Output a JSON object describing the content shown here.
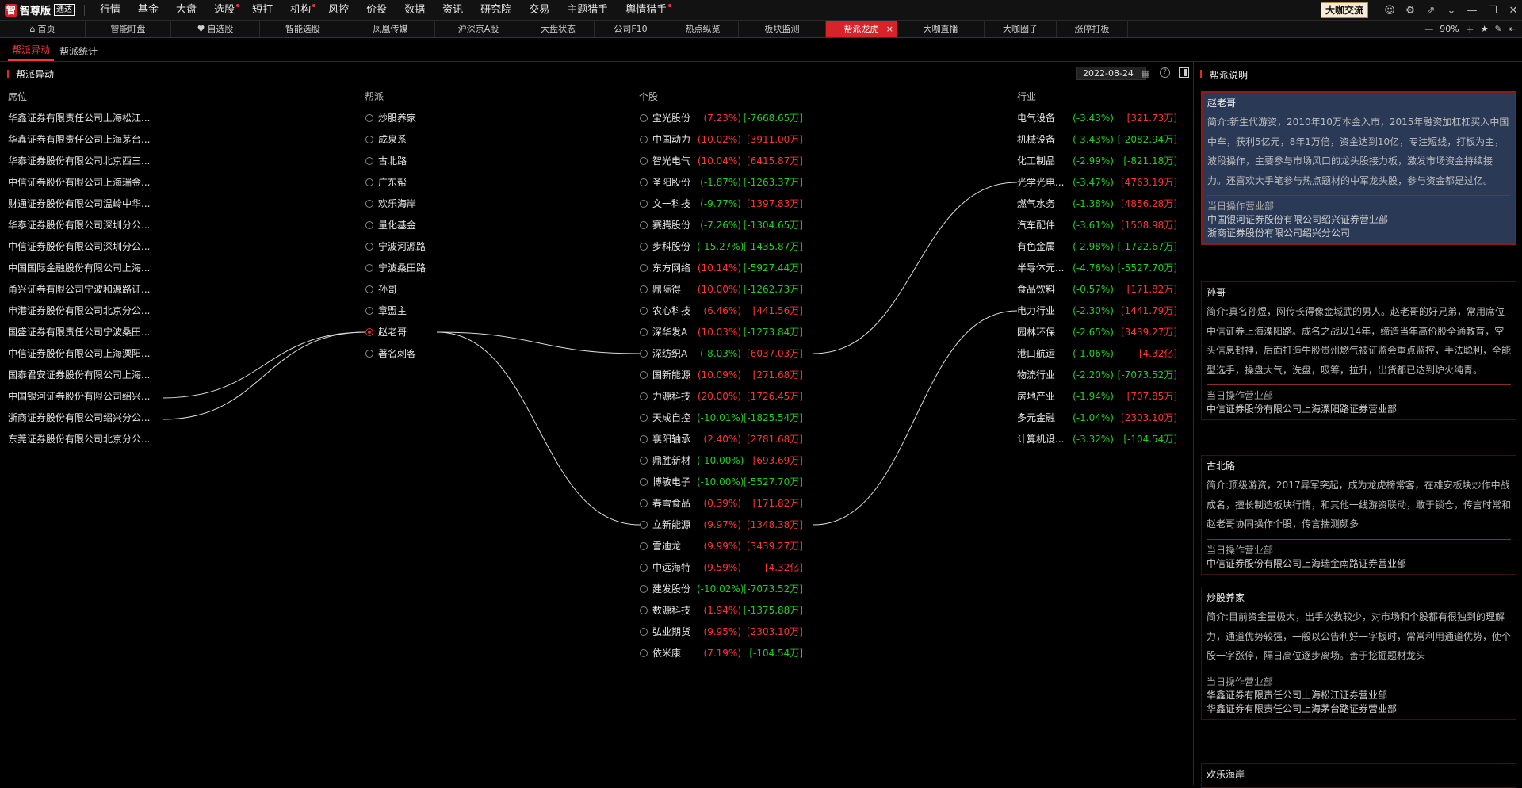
{
  "app": {
    "logo_badge": "智",
    "logo_text": "智尊版",
    "logo_sub": "通达",
    "menu": [
      {
        "label": "行情",
        "dot": false
      },
      {
        "label": "基金",
        "dot": false
      },
      {
        "label": "大盘",
        "dot": false
      },
      {
        "label": "选股",
        "dot": true
      },
      {
        "label": "短打",
        "dot": false
      },
      {
        "label": "机构",
        "dot": true
      },
      {
        "label": "风控",
        "dot": false
      },
      {
        "label": "价投",
        "dot": false
      },
      {
        "label": "数据",
        "dot": false
      },
      {
        "label": "资讯",
        "dot": false
      },
      {
        "label": "研究院",
        "dot": false
      },
      {
        "label": "交易",
        "dot": false
      },
      {
        "label": "主题猎手",
        "dot": false
      },
      {
        "label": "舆情猎手",
        "dot": true
      }
    ],
    "bigv_button": "大咖交流"
  },
  "tabs": [
    {
      "label": "首页",
      "icon": "home-icon",
      "active": false
    },
    {
      "label": "智能盯盘",
      "active": false
    },
    {
      "label": "自选股",
      "icon": "heart-icon",
      "active": false
    },
    {
      "label": "智能选股",
      "active": false
    },
    {
      "label": "凤凰传媒",
      "active": false
    },
    {
      "label": "沪深京A股",
      "active": false
    },
    {
      "label": "大盘状态",
      "active": false
    },
    {
      "label": "公司F10",
      "active": false
    },
    {
      "label": "热点纵览",
      "active": false
    },
    {
      "label": "板块监测",
      "active": false
    },
    {
      "label": "帮派龙虎",
      "active": true
    },
    {
      "label": "大咖直播",
      "active": false
    },
    {
      "label": "大咖圈子",
      "active": false
    },
    {
      "label": "涨停打板",
      "active": false
    }
  ],
  "zoom": "90%",
  "subtabs": [
    {
      "label": "帮派异动",
      "active": true
    },
    {
      "label": "帮派统计",
      "active": false
    }
  ],
  "panel": {
    "title": "帮派异动",
    "date": "2022-08-24",
    "headers": {
      "seat": "席位",
      "gang": "帮派",
      "stock": "个股",
      "industry": "行业"
    }
  },
  "seats": [
    "华鑫证券有限责任公司上海松江...",
    "华鑫证券有限责任公司上海茅台...",
    "华泰证券股份有限公司北京西三...",
    "中信证券股份有限公司上海瑞金...",
    "财通证券股份有限公司温岭中华...",
    "华泰证券股份有限公司深圳分公...",
    "中信证券股份有限公司深圳分公...",
    "中国国际金融股份有限公司上海...",
    "甬兴证券有限公司宁波和源路证...",
    "申港证券股份有限公司北京分公...",
    "国盛证券有限责任公司宁波桑田...",
    "中信证券股份有限公司上海溧阳...",
    "国泰君安证券股份有限公司上海...",
    "中国银河证券股份有限公司绍兴...",
    "浙商证券股份有限公司绍兴分公...",
    "东莞证券股份有限公司北京分公..."
  ],
  "gangs": [
    {
      "name": "炒股养家",
      "selected": false
    },
    {
      "name": "成泉系",
      "selected": false
    },
    {
      "name": "古北路",
      "selected": false
    },
    {
      "name": "广东帮",
      "selected": false
    },
    {
      "name": "欢乐海岸",
      "selected": false
    },
    {
      "name": "量化基金",
      "selected": false
    },
    {
      "name": "宁波河源路",
      "selected": false
    },
    {
      "name": "宁波桑田路",
      "selected": false
    },
    {
      "name": "孙哥",
      "selected": false
    },
    {
      "name": "章盟主",
      "selected": false
    },
    {
      "name": "赵老哥",
      "selected": true
    },
    {
      "name": "著名刺客",
      "selected": false
    }
  ],
  "stocks": [
    {
      "name": "宝光股份",
      "pct": "(7.23%)",
      "amt": "[-7668.65万]",
      "pct_dir": "up",
      "amt_dir": "down"
    },
    {
      "name": "中国动力",
      "pct": "(10.02%)",
      "amt": "[3911.00万]",
      "pct_dir": "up",
      "amt_dir": "up"
    },
    {
      "name": "智光电气",
      "pct": "(10.04%)",
      "amt": "[6415.87万]",
      "pct_dir": "up",
      "amt_dir": "up"
    },
    {
      "name": "圣阳股份",
      "pct": "(-1.87%)",
      "amt": "[-1263.37万]",
      "pct_dir": "down",
      "amt_dir": "down"
    },
    {
      "name": "文一科技",
      "pct": "(-9.77%)",
      "amt": "[1397.83万]",
      "pct_dir": "down",
      "amt_dir": "up"
    },
    {
      "name": "赛腾股份",
      "pct": "(-7.26%)",
      "amt": "[-1304.65万]",
      "pct_dir": "down",
      "amt_dir": "down"
    },
    {
      "name": "步科股份",
      "pct": "(-15.27%)",
      "amt": "[-1435.87万]",
      "pct_dir": "down",
      "amt_dir": "down"
    },
    {
      "name": "东方网络",
      "pct": "(10.14%)",
      "amt": "[-5927.44万]",
      "pct_dir": "up",
      "amt_dir": "down"
    },
    {
      "name": "鼎际得",
      "pct": "(10.00%)",
      "amt": "[-1262.73万]",
      "pct_dir": "up",
      "amt_dir": "down"
    },
    {
      "name": "农心科技",
      "pct": "(6.46%)",
      "amt": "[441.56万]",
      "pct_dir": "up",
      "amt_dir": "up"
    },
    {
      "name": "深华发A",
      "pct": "(10.03%)",
      "amt": "[-1273.84万]",
      "pct_dir": "up",
      "amt_dir": "down"
    },
    {
      "name": "深纺织A",
      "pct": "(-8.03%)",
      "amt": "[6037.03万]",
      "pct_dir": "down",
      "amt_dir": "up"
    },
    {
      "name": "国新能源",
      "pct": "(10.09%)",
      "amt": "[271.68万]",
      "pct_dir": "up",
      "amt_dir": "up"
    },
    {
      "name": "力源科技",
      "pct": "(20.00%)",
      "amt": "[1726.45万]",
      "pct_dir": "up",
      "amt_dir": "up"
    },
    {
      "name": "天成自控",
      "pct": "(-10.01%)",
      "amt": "[-1825.54万]",
      "pct_dir": "down",
      "amt_dir": "down"
    },
    {
      "name": "襄阳轴承",
      "pct": "(2.40%)",
      "amt": "[2781.68万]",
      "pct_dir": "up",
      "amt_dir": "up"
    },
    {
      "name": "鼎胜新材",
      "pct": "(-10.00%)",
      "amt": "[693.69万]",
      "pct_dir": "down",
      "amt_dir": "up"
    },
    {
      "name": "博敏电子",
      "pct": "(-10.00%)",
      "amt": "[-5527.70万]",
      "pct_dir": "down",
      "amt_dir": "down"
    },
    {
      "name": "春雪食品",
      "pct": "(0.39%)",
      "amt": "[171.82万]",
      "pct_dir": "up",
      "amt_dir": "up"
    },
    {
      "name": "立新能源",
      "pct": "(9.97%)",
      "amt": "[1348.38万]",
      "pct_dir": "up",
      "amt_dir": "up"
    },
    {
      "name": "雪迪龙",
      "pct": "(9.99%)",
      "amt": "[3439.27万]",
      "pct_dir": "up",
      "amt_dir": "up"
    },
    {
      "name": "中远海特",
      "pct": "(9.59%)",
      "amt": "[4.32亿]",
      "pct_dir": "up",
      "amt_dir": "up"
    },
    {
      "name": "建发股份",
      "pct": "(-10.02%)",
      "amt": "[-7073.52万]",
      "pct_dir": "down",
      "amt_dir": "down"
    },
    {
      "name": "数源科技",
      "pct": "(1.94%)",
      "amt": "[-1375.88万]",
      "pct_dir": "up",
      "amt_dir": "down"
    },
    {
      "name": "弘业期货",
      "pct": "(9.95%)",
      "amt": "[2303.10万]",
      "pct_dir": "up",
      "amt_dir": "up"
    },
    {
      "name": "依米康",
      "pct": "(7.19%)",
      "amt": "[-104.54万]",
      "pct_dir": "up",
      "amt_dir": "down"
    }
  ],
  "industries": [
    {
      "name": "电气设备",
      "pct": "(-3.43%)",
      "amt": "[321.73万]",
      "amt_dir": "up"
    },
    {
      "name": "机械设备",
      "pct": "(-3.43%)",
      "amt": "[-2082.94万]",
      "amt_dir": "down"
    },
    {
      "name": "化工制品",
      "pct": "(-2.99%)",
      "amt": "[-821.18万]",
      "amt_dir": "down"
    },
    {
      "name": "光学光电...",
      "pct": "(-3.47%)",
      "amt": "[4763.19万]",
      "amt_dir": "up"
    },
    {
      "name": "燃气水务",
      "pct": "(-1.38%)",
      "amt": "[4856.28万]",
      "amt_dir": "up"
    },
    {
      "name": "汽车配件",
      "pct": "(-3.61%)",
      "amt": "[1508.98万]",
      "amt_dir": "up"
    },
    {
      "name": "有色金属",
      "pct": "(-2.98%)",
      "amt": "[-1722.67万]",
      "amt_dir": "down"
    },
    {
      "name": "半导体元...",
      "pct": "(-4.76%)",
      "amt": "[-5527.70万]",
      "amt_dir": "down"
    },
    {
      "name": "食品饮料",
      "pct": "(-0.57%)",
      "amt": "[171.82万]",
      "amt_dir": "up"
    },
    {
      "name": "电力行业",
      "pct": "(-2.30%)",
      "amt": "[1441.79万]",
      "amt_dir": "up"
    },
    {
      "name": "园林环保",
      "pct": "(-2.65%)",
      "amt": "[3439.27万]",
      "amt_dir": "up"
    },
    {
      "name": "港口航运",
      "pct": "(-1.06%)",
      "amt": "[4.32亿]",
      "amt_dir": "up"
    },
    {
      "name": "物流行业",
      "pct": "(-2.20%)",
      "amt": "[-7073.52万]",
      "amt_dir": "down"
    },
    {
      "name": "房地产业",
      "pct": "(-1.94%)",
      "amt": "[707.85万]",
      "amt_dir": "up"
    },
    {
      "name": "多元金融",
      "pct": "(-1.04%)",
      "amt": "[2303.10万]",
      "amt_dir": "up"
    },
    {
      "name": "计算机设...",
      "pct": "(-3.32%)",
      "amt": "[-104.54万]",
      "amt_dir": "down"
    }
  ],
  "links": {
    "seat_to_gang": [
      [
        13,
        10
      ],
      [
        14,
        10
      ]
    ],
    "gang_to_stock": [
      [
        10,
        11
      ],
      [
        10,
        19
      ]
    ],
    "stock_to_industry": [
      [
        11,
        3
      ],
      [
        19,
        9
      ]
    ]
  },
  "sidebar": {
    "title": "帮派说明",
    "op_label": "当日操作营业部",
    "cards": [
      {
        "name": "赵老哥",
        "selected": true,
        "desc": "简介:新生代游资，2010年10万本金入市，2015年融资加杠杠买入中国中车，获利5亿元，8年1万倍，资金达到10亿，专注短线，打板为主，波段操作，主要参与市场风口的龙头股接力板，激发市场资金持续接力。还喜欢大手笔参与热点题材的中军龙头股，参与资金都是过亿。",
        "ops": [
          "中国银河证券股份有限公司绍兴证券营业部",
          "浙商证券股份有限公司绍兴分公司"
        ]
      },
      {
        "name": "孙哥",
        "selected": false,
        "desc": "简介:真名孙煜，网传长得像金城武的男人。赵老哥的好兄弟，常用席位中信证券上海溧阳路。成名之战以14年，缔造当年高价股全通教育，空头信息封神，后面打造牛股贵州燃气被证监会重点监控，手法聪利，全能型选手，操盘大气，洗盘，吸筹，拉升，出货都已达到炉火纯青。",
        "ops": [
          "中信证券股份有限公司上海溧阳路证券营业部"
        ]
      },
      {
        "name": "古北路",
        "selected": false,
        "desc": "简介:顶级游资，2017异军突起，成为龙虎榜常客，在雄安板块炒作中战成名，擅长制造板块行情，和其他一线游资联动，敢于锁仓，传言时常和赵老哥协同操作个股，传言揣测颇多",
        "ops": [
          "中信证券股份有限公司上海瑞金南路证券营业部"
        ]
      },
      {
        "name": "炒股养家",
        "selected": false,
        "desc": "简介:目前资金量极大，出手次数较少，对市场和个股都有很独到的理解力，通道优势较强，一般以公告利好一字板时，常常利用通道优势，使个股一字涨停，隔日高位逐步离场。善于挖掘题材龙头",
        "ops": [
          "华鑫证券有限责任公司上海松江证券营业部",
          "华鑫证券有限责任公司上海茅台路证券营业部"
        ]
      },
      {
        "name": "欢乐海岸",
        "selected": false,
        "desc": "",
        "ops": []
      }
    ]
  }
}
